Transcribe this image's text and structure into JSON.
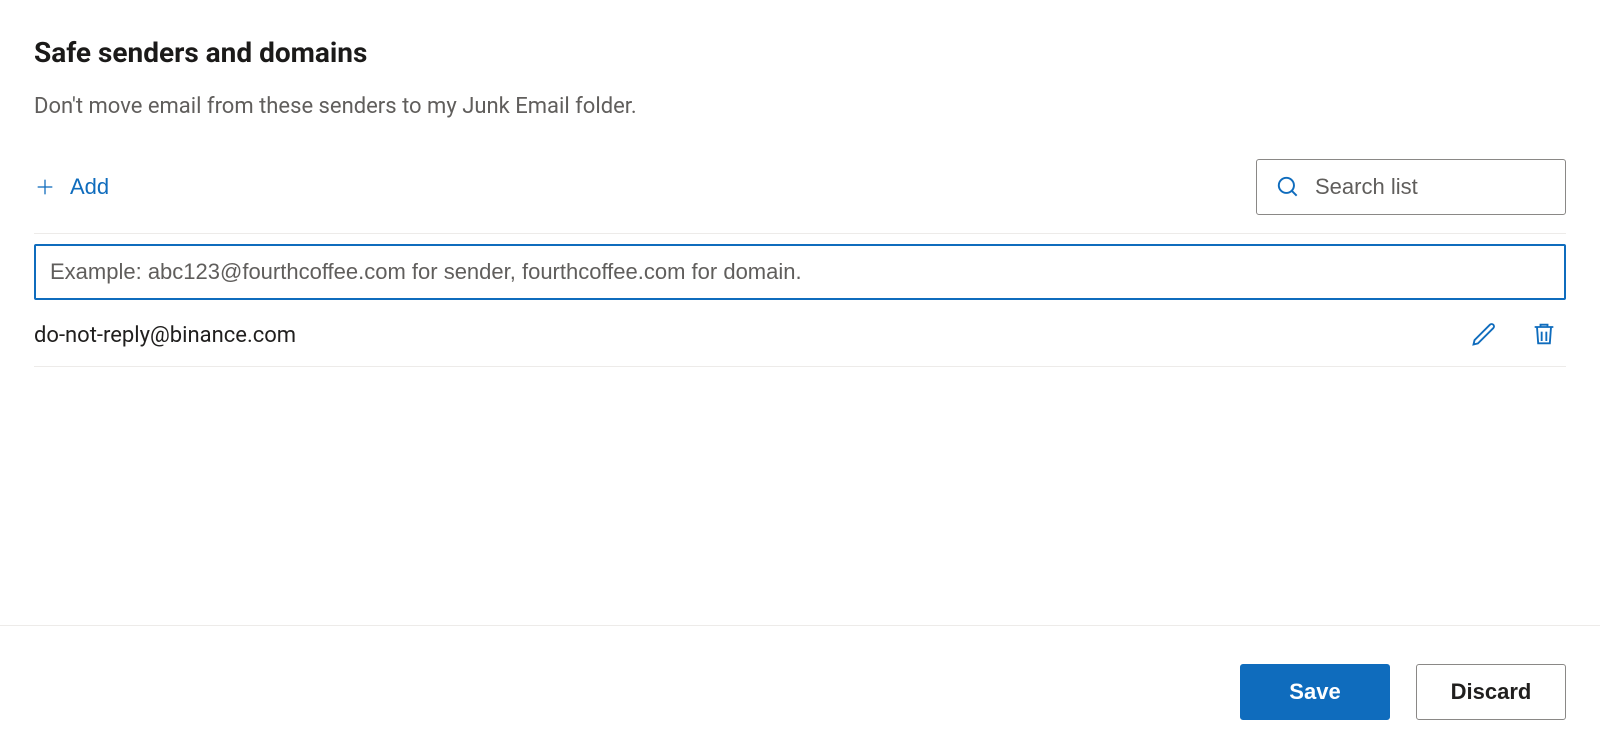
{
  "header": {
    "title": "Safe senders and domains",
    "description": "Don't move email from these senders to my Junk Email folder."
  },
  "toolbar": {
    "add_label": "Add",
    "search_placeholder": "Search list"
  },
  "add_entry": {
    "value": "",
    "placeholder": "Example: abc123@fourthcoffee.com for sender, fourthcoffee.com for domain."
  },
  "list": {
    "items": [
      {
        "email": "do-not-reply@binance.com"
      }
    ]
  },
  "footer": {
    "save_label": "Save",
    "discard_label": "Discard"
  }
}
